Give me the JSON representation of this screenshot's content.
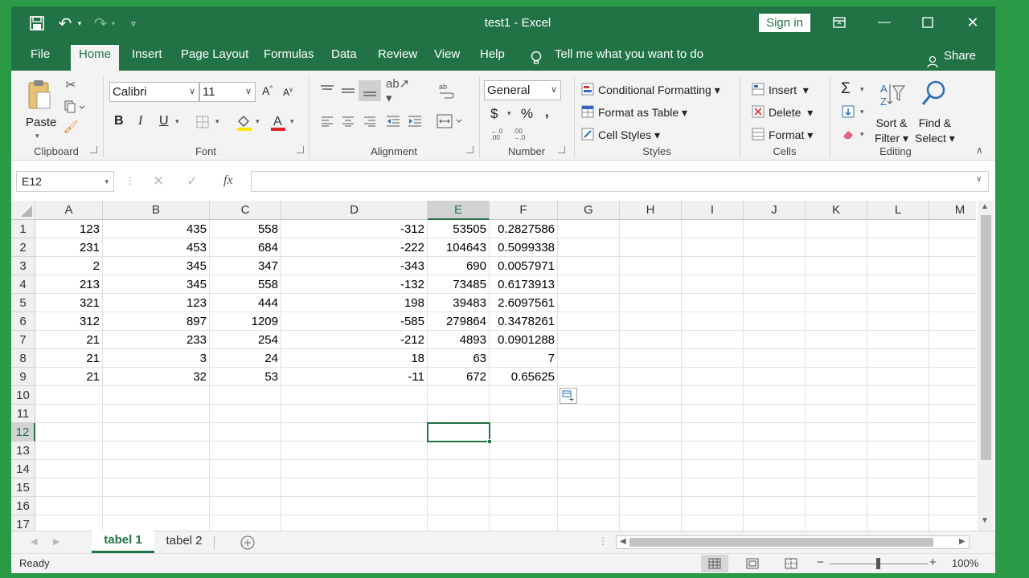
{
  "titlebar": {
    "title": "test1  -  Excel",
    "sign_in": "Sign in"
  },
  "tabs": [
    "File",
    "Home",
    "Insert",
    "Page Layout",
    "Formulas",
    "Data",
    "Review",
    "View",
    "Help"
  ],
  "tell_me": "Tell me what you want to do",
  "share": "Share",
  "ribbon": {
    "clipboard": {
      "label": "Clipboard",
      "paste": "Paste"
    },
    "font": {
      "label": "Font",
      "name": "Calibri",
      "size": "11",
      "bold": "B",
      "italic": "I",
      "underline": "U"
    },
    "alignment": {
      "label": "Alignment"
    },
    "number": {
      "label": "Number",
      "format": "General",
      "currency": "$",
      "percent": "%",
      "comma": ","
    },
    "styles": {
      "label": "Styles",
      "conditional": "Conditional Formatting",
      "format_table": "Format as Table",
      "cell_styles": "Cell Styles"
    },
    "cells": {
      "label": "Cells",
      "insert": "Insert",
      "delete": "Delete",
      "format": "Format"
    },
    "editing": {
      "label": "Editing",
      "sort1": "Sort &",
      "sort2": "Filter",
      "find1": "Find &",
      "find2": "Select"
    }
  },
  "formula_bar": {
    "name_box": "E12",
    "fx": "fx",
    "formula": ""
  },
  "columns": [
    "A",
    "B",
    "C",
    "D",
    "E",
    "F",
    "G",
    "H",
    "I",
    "J",
    "K",
    "L",
    "M"
  ],
  "rows": [
    "1",
    "2",
    "3",
    "4",
    "5",
    "6",
    "7",
    "8",
    "9",
    "10",
    "11",
    "12",
    "13",
    "14",
    "15",
    "16",
    "17"
  ],
  "cells": [
    [
      "123",
      "435",
      "558",
      "-312",
      "53505",
      "0.2827586"
    ],
    [
      "231",
      "453",
      "684",
      "-222",
      "104643",
      "0.5099338"
    ],
    [
      "2",
      "345",
      "347",
      "-343",
      "690",
      "0.0057971"
    ],
    [
      "213",
      "345",
      "558",
      "-132",
      "73485",
      "0.6173913"
    ],
    [
      "321",
      "123",
      "444",
      "198",
      "39483",
      "2.6097561"
    ],
    [
      "312",
      "897",
      "1209",
      "-585",
      "279864",
      "0.3478261"
    ],
    [
      "21",
      "233",
      "254",
      "-212",
      "4893",
      "0.0901288"
    ],
    [
      "21",
      "3",
      "24",
      "18",
      "63",
      "7"
    ],
    [
      "21",
      "32",
      "53",
      "-11",
      "672",
      "0.65625"
    ]
  ],
  "sheets": [
    "tabel 1",
    "tabel 2"
  ],
  "status": {
    "ready": "Ready",
    "zoom": "100%"
  },
  "colors": {
    "brand": "#217346"
  }
}
